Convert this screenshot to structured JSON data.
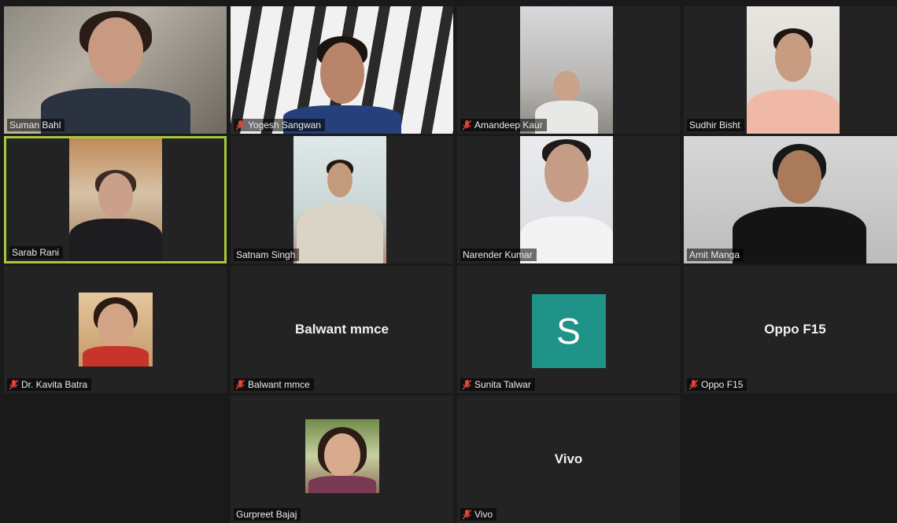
{
  "participants": [
    {
      "name": "Suman Bahl",
      "muted": false
    },
    {
      "name": "Yogesh Sangwan",
      "muted": true
    },
    {
      "name": "Amandeep Kaur",
      "muted": true
    },
    {
      "name": "Sudhir Bisht",
      "muted": false
    },
    {
      "name": "Sarab Rani",
      "muted": false
    },
    {
      "name": "Satnam Singh",
      "muted": false
    },
    {
      "name": "Narender Kumar",
      "muted": false
    },
    {
      "name": "Amit Manga",
      "muted": false
    },
    {
      "name": "Dr. Kavita Batra",
      "muted": true
    },
    {
      "name": "Balwant mmce",
      "muted": true,
      "display_name": "Balwant mmce"
    },
    {
      "name": "Sunita Talwar",
      "muted": true,
      "avatar_letter": "S"
    },
    {
      "name": "Oppo F15",
      "muted": true,
      "display_name": "Oppo F15"
    },
    {
      "name": "Gurpreet Bajaj",
      "muted": false
    },
    {
      "name": "Vivo",
      "muted": true,
      "display_name": "Vivo"
    }
  ],
  "colors": {
    "active_speaker_border": "#a6c93a",
    "avatar_bg": "#1f9387",
    "mute_icon": "#e0443a"
  }
}
